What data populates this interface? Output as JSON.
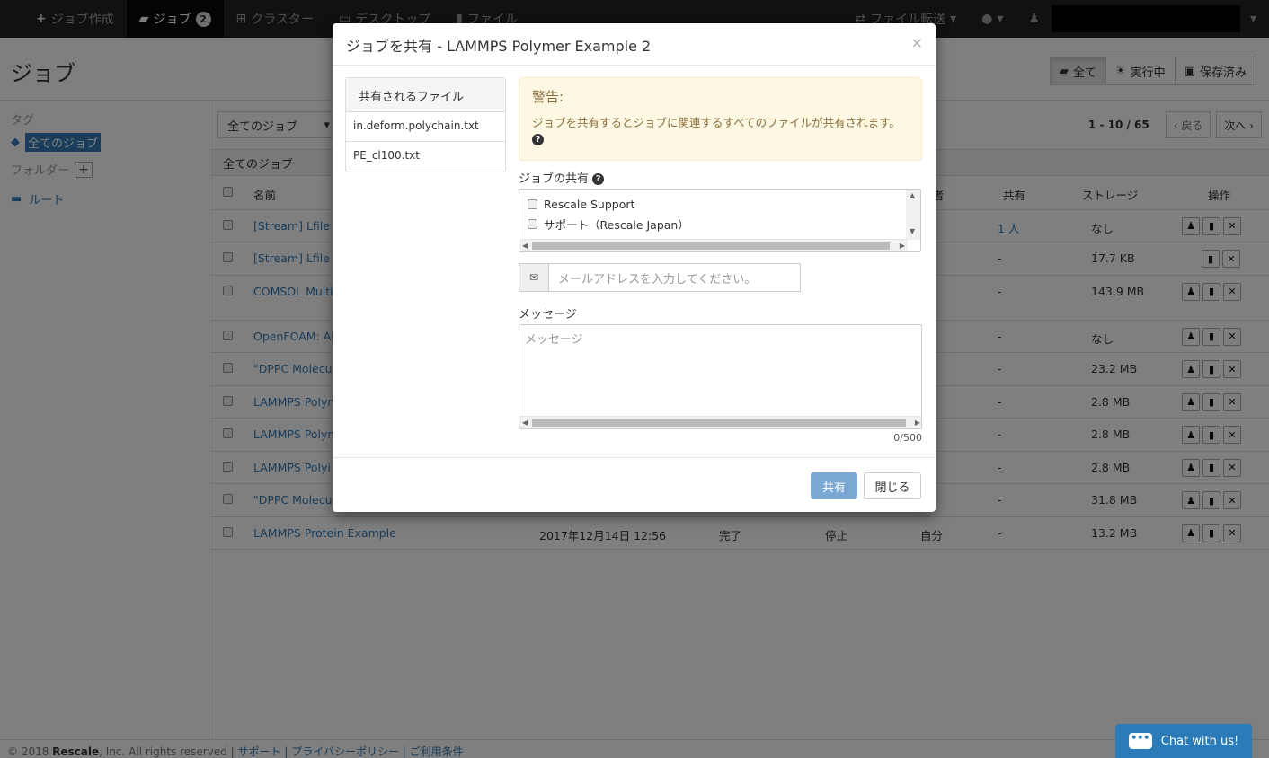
{
  "nav": {
    "create_job": "ジョブ作成",
    "jobs": "ジョブ",
    "jobs_badge": "2",
    "clusters": "クラスター",
    "desktops": "デスクトップ",
    "files": "ファイル",
    "file_transfer": "ファイル転送"
  },
  "page": {
    "title": "ジョブ",
    "filter_all": "全て",
    "filter_running": "実行中",
    "filter_saved": "保存済み"
  },
  "sidebar": {
    "tags_label": "タグ",
    "all_jobs_tag": "全てのジョブ",
    "folders_label": "フォルダー",
    "folder_add": "+",
    "root": "ルート"
  },
  "toolbar": {
    "job_filter": "全てのジョブ",
    "page_count": "1 - 10 / 65",
    "prev": "‹ 戻る",
    "next": "次へ ›",
    "folder_title": "全てのジョブ"
  },
  "table": {
    "headers": {
      "name": "名前",
      "owner": "者",
      "shared": "共有",
      "storage": "ストレージ",
      "actions": "操作"
    },
    "rows": [
      {
        "name": "[Stream] Lfile c",
        "date": "",
        "status": "",
        "run": "",
        "owner": "分",
        "shared": "1 人",
        "storage": "なし"
      },
      {
        "name": "[Stream] Lfile c",
        "date": "",
        "status": "",
        "run": "",
        "owner": "o",
        "shared": "-",
        "storage": "17.7 KB"
      },
      {
        "name": "COMSOL Multi",
        "date": "",
        "status": "",
        "run": "",
        "owner": "分",
        "shared": "-",
        "storage": "143.9 MB"
      },
      {
        "name": "OpenFOAM: Ai",
        "date": "",
        "status": "",
        "run": "",
        "owner": "分",
        "shared": "-",
        "storage": "なし"
      },
      {
        "name": "\"DPPC Molecul",
        "date": "",
        "status": "",
        "run": "",
        "owner": "分",
        "shared": "-",
        "storage": "23.2 MB"
      },
      {
        "name": "LAMMPS Polym",
        "date": "",
        "status": "",
        "run": "",
        "owner": "分",
        "shared": "-",
        "storage": "2.8 MB"
      },
      {
        "name": "LAMMPS Polym",
        "date": "",
        "status": "",
        "run": "",
        "owner": "分",
        "shared": "-",
        "storage": "2.8 MB"
      },
      {
        "name": "LAMMPS Polyi",
        "date": "",
        "status": "",
        "run": "",
        "owner": "分",
        "shared": "-",
        "storage": "2.8 MB"
      },
      {
        "name": "\"DPPC Molecul",
        "date": "",
        "status": "",
        "run": "",
        "owner": "分",
        "shared": "-",
        "storage": "31.8 MB"
      },
      {
        "name": "LAMMPS Protein Example",
        "date": "2017年12月14日 12:56",
        "status": "完了",
        "run": "停止",
        "owner": "自分",
        "shared": "-",
        "storage": "13.2 MB"
      }
    ]
  },
  "modal": {
    "title": "ジョブを共有 - LAMMPS Polymer Example 2",
    "close": "×",
    "files_header": "共有されるファイル",
    "files": [
      "in.deform.polychain.txt",
      "PE_cl100.txt"
    ],
    "warning_title": "警告:",
    "warning_text": "ジョブを共有するとジョブに関連するすべてのファイルが共有されます。",
    "share_label": "ジョブの共有",
    "share_options": [
      "Rescale Support",
      "サポート（Rescale Japan）"
    ],
    "email_placeholder": "メールアドレスを入力してください。",
    "message_label": "メッセージ",
    "message_placeholder": "メッセージ",
    "char_count": "0/500",
    "share_button": "共有",
    "close_button": "閉じる"
  },
  "footer": {
    "copyright_prefix": "© 2018 ",
    "company": "Rescale",
    "copyright_suffix": ", Inc. All rights reserved | ",
    "links": "サポート | プライバシーポリシー | ご利用条件"
  },
  "chat": {
    "label": "Chat with us!"
  }
}
